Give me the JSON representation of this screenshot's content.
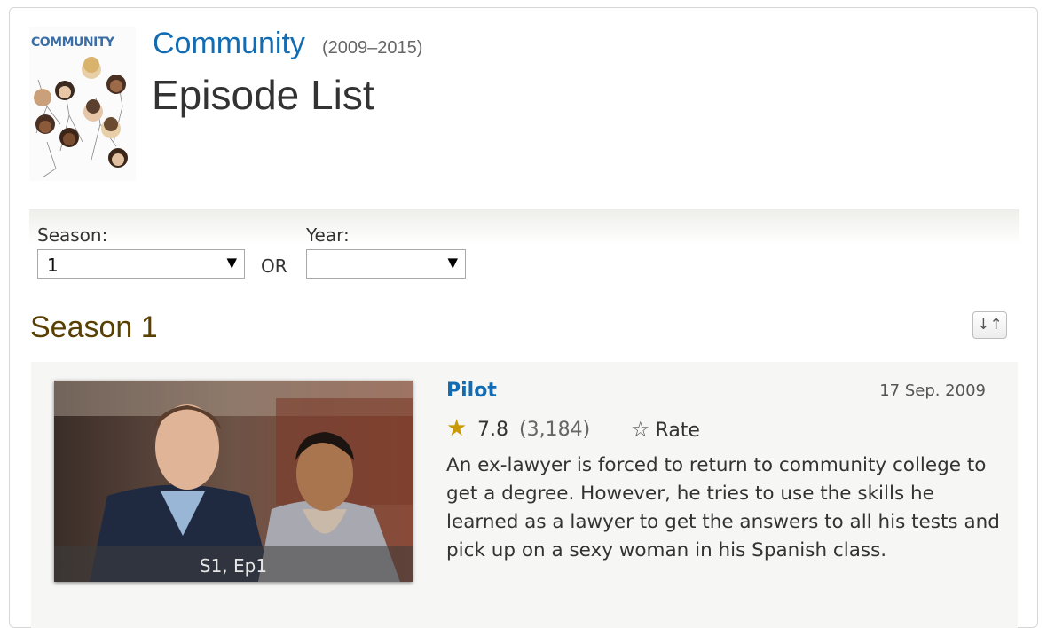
{
  "header": {
    "poster_logo": "COMMUNITY",
    "show_title": "Community",
    "show_years": "(2009–2015)",
    "page_title": "Episode List"
  },
  "filters": {
    "season_label": "Season:",
    "season_value": "1",
    "or_label": "OR",
    "year_label": "Year:",
    "year_value": ""
  },
  "season_heading": "Season 1",
  "sort_icon": "sort-toggle-icon",
  "episodes": [
    {
      "code": "S1, Ep1",
      "title": "Pilot",
      "air_date": "17 Sep. 2009",
      "rating": "7.8",
      "votes": "(3,184)",
      "rate_label": "Rate",
      "description": "An ex-lawyer is forced to return to community college to get a degree. However, he tries to use the skills he learned as a lawyer to get the answers to all his tests and pick up on a sexy woman in his Spanish class."
    }
  ],
  "colors": {
    "link": "#136cb2",
    "season_heading": "#5a4000",
    "star": "#c99a06",
    "card_bg": "#f6f6f5"
  }
}
